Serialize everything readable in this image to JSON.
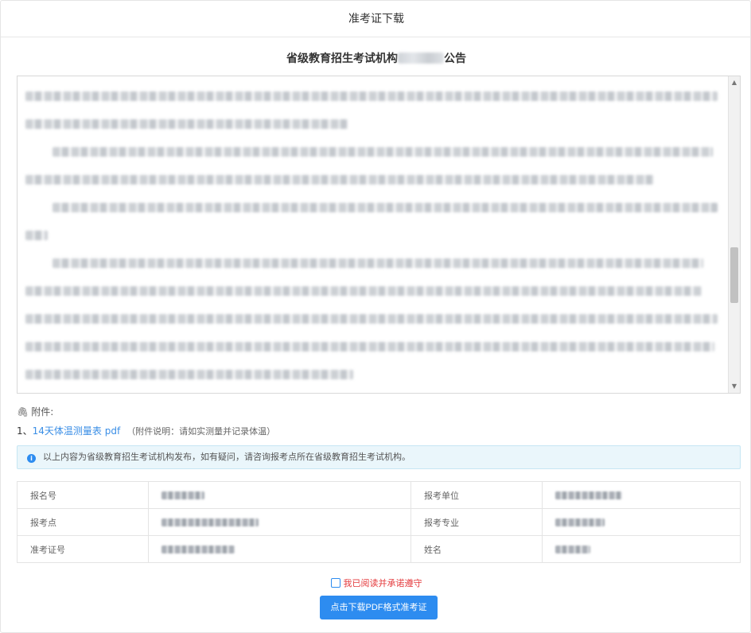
{
  "header": {
    "title": "准考证下载"
  },
  "notice": {
    "title_prefix": "省级教育招生考试机构",
    "title_suffix": "公告"
  },
  "attachments": {
    "heading": "附件:",
    "items": [
      {
        "index": "1、",
        "link_text": "14天体温测量表 pdf",
        "note": "（附件说明：请如实测量并记录体温）"
      }
    ]
  },
  "info_bar": {
    "text": "以上内容为省级教育招生考试机构发布，如有疑问，请咨询报考点所在省级教育招生考试机构。"
  },
  "table": {
    "rows": [
      {
        "label1": "报名号",
        "label2": "报考单位"
      },
      {
        "label1": "报考点",
        "label2": "报考专业"
      },
      {
        "label1": "准考证号",
        "label2": "姓名"
      }
    ]
  },
  "agreement": {
    "label": "我已阅读并承诺遵守"
  },
  "download_button": {
    "label": "点击下载PDF格式准考证"
  },
  "colors": {
    "accent": "#2d8cf0",
    "link": "#3a8ee6",
    "agree_text": "#e4393c",
    "info_bg": "#eaf6fb"
  },
  "icons": {
    "attachment": "paperclip-icon",
    "info": "info-circle-icon"
  }
}
